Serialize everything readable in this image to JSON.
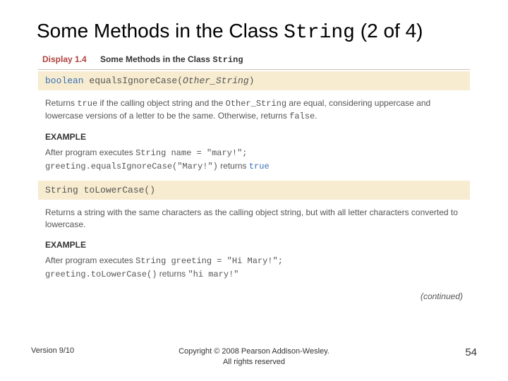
{
  "title_prefix": "Some Methods in the Class ",
  "title_code": "String",
  "title_suffix": " (2 of 4)",
  "display": {
    "label": "Display 1.4",
    "title_prefix": "Some Methods in the Class ",
    "title_code": "String"
  },
  "method1": {
    "sig_kw": "boolean",
    "sig_rest": " equalsIgnoreCase(",
    "sig_param": "Other_String",
    "sig_close": ")",
    "desc_p1": "Returns ",
    "desc_true": "true",
    "desc_p2": " if the calling object string and the ",
    "desc_param": "Other_String",
    "desc_p3": " are equal, considering uppercase and lowercase versions of a letter to be the same. Otherwise, returns ",
    "desc_false": "false",
    "desc_p4": ".",
    "example_label": "EXAMPLE",
    "ex_l1a": "After program executes ",
    "ex_l1b": "String name = \"mary!\";",
    "ex_l2a": "greeting.equalsIgnoreCase(\"Mary!\")",
    "ex_l2b": " returns ",
    "ex_l2c": "true"
  },
  "method2": {
    "sig": "String toLowerCase()",
    "desc": "Returns a string with the same characters as the calling object string, but with all letter characters converted to lowercase.",
    "example_label": "EXAMPLE",
    "ex_l1a": "After program executes ",
    "ex_l1b": "String greeting = \"Hi Mary!\";",
    "ex_l2a": "greeting.toLowerCase()",
    "ex_l2b": " returns ",
    "ex_l2c": "\"hi mary!\""
  },
  "continued": "(continued)",
  "footer": {
    "version": "Version 9/10",
    "copyright_l1": "Copyright © 2008 Pearson Addison-Wesley.",
    "copyright_l2": "All rights reserved",
    "page": "54"
  }
}
